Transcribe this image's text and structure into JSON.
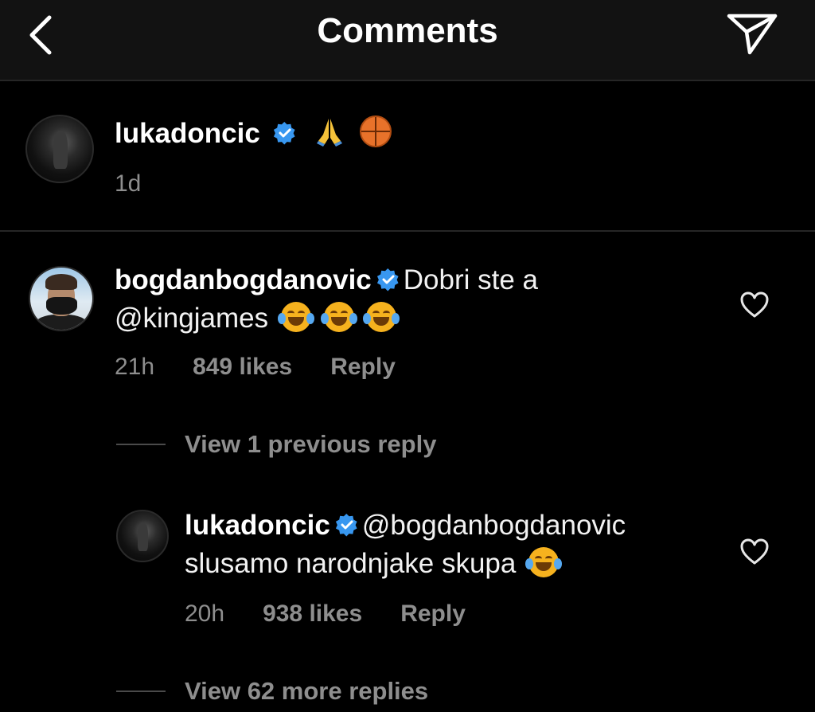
{
  "header": {
    "title": "Comments",
    "back_icon": "chevron-left-icon",
    "share_icon": "paper-plane-icon"
  },
  "caption": {
    "username": "lukadoncic",
    "verified": true,
    "text_emojis": [
      "folded-hands",
      "basketball"
    ],
    "time": "1d"
  },
  "comments": [
    {
      "username": "bogdanbogdanovic",
      "verified": true,
      "text_line1": "Dobri ste a",
      "text_line2": "@kingjames",
      "emojis": [
        "face-with-tears-of-joy",
        "face-with-tears-of-joy",
        "face-with-tears-of-joy"
      ],
      "time": "21h",
      "likes": "849 likes",
      "reply_label": "Reply",
      "view_replies": "View 1 previous reply"
    },
    {
      "username": "lukadoncic",
      "verified": true,
      "text_line1": "@bogdanbogdanovic",
      "text_line2": "slusamo narodnjake skupa",
      "emojis": [
        "face-with-tears-of-joy"
      ],
      "time": "20h",
      "likes": "938 likes",
      "reply_label": "Reply",
      "view_replies": "View 62 more replies"
    }
  ],
  "colors": {
    "background": "#000000",
    "header": "#121212",
    "muted_text": "#8e8e8e",
    "verified_blue": "#3897f0"
  }
}
